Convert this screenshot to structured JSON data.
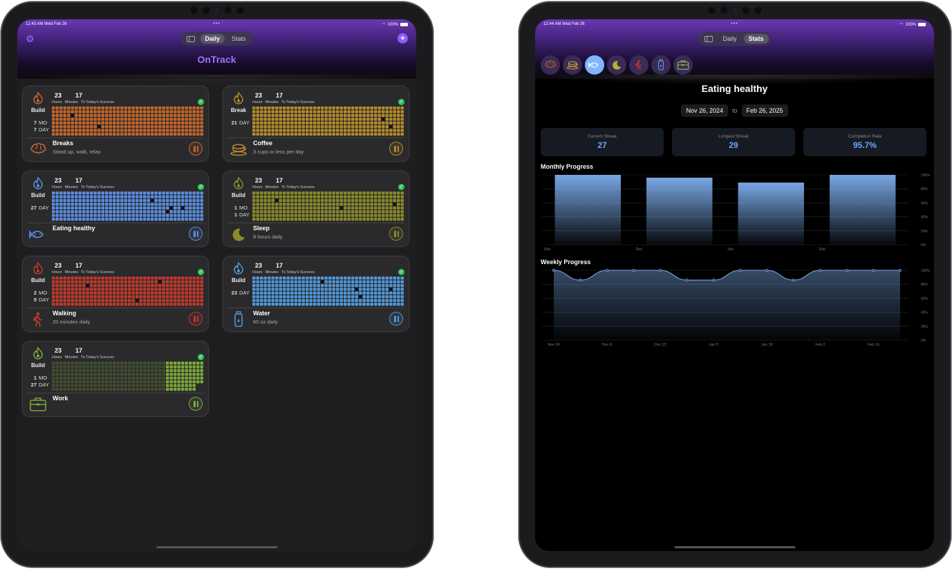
{
  "left": {
    "status": {
      "time": "12:43 AM  Wed Feb 26",
      "battery": "100%"
    },
    "tabs": [
      "Daily",
      "Stats"
    ],
    "active_tab": "Daily",
    "app_title": "OnTrack",
    "labels": {
      "hours": "Hours",
      "minutes": "Minutes",
      "to_success": "To Today's Success"
    },
    "habits": [
      {
        "name": "Breaks",
        "desc": "Stand up, walk, relax",
        "mode": "Build",
        "hours": "23",
        "minutes": "17",
        "stats": [
          {
            "n": "7",
            "u": "MO"
          },
          {
            "n": "7",
            "u": "DAY"
          }
        ],
        "color": "#c4652a",
        "fill_fraction": 1.0,
        "icon": "brain-icon"
      },
      {
        "name": "Coffee",
        "desc": "3 cups or less per day",
        "mode": "Break",
        "hours": "23",
        "minutes": "17",
        "stats": [
          {
            "n": "21",
            "u": "DAY"
          }
        ],
        "color": "#b58a2a",
        "fill_fraction": 1.0,
        "icon": "coffee-cup-icon"
      },
      {
        "name": "Eating healthy",
        "desc": "",
        "mode": "Build",
        "hours": "23",
        "minutes": "17",
        "stats": [
          {
            "n": "27",
            "u": "DAY"
          }
        ],
        "color": "#5a8ee0",
        "fill_fraction": 1.0,
        "icon": "fish-icon"
      },
      {
        "name": "Sleep",
        "desc": "8 hours daily",
        "mode": "Build",
        "hours": "23",
        "minutes": "17",
        "stats": [
          {
            "n": "1",
            "u": "MO"
          },
          {
            "n": "1",
            "u": "DAY"
          }
        ],
        "color": "#8a8a2a",
        "fill_fraction": 1.0,
        "icon": "moon-icon"
      },
      {
        "name": "Walking",
        "desc": "20 minutes daily",
        "mode": "Build",
        "hours": "23",
        "minutes": "17",
        "stats": [
          {
            "n": "2",
            "u": "MO"
          },
          {
            "n": "5",
            "u": "DAY"
          }
        ],
        "color": "#c0392b",
        "fill_fraction": 1.0,
        "icon": "walking-person-icon"
      },
      {
        "name": "Water",
        "desc": "60 oz daily",
        "mode": "Build",
        "hours": "23",
        "minutes": "17",
        "stats": [
          {
            "n": "23",
            "u": "DAY"
          }
        ],
        "color": "#4f98d8",
        "fill_fraction": 1.0,
        "icon": "water-bottle-icon"
      },
      {
        "name": "Work",
        "desc": "",
        "mode": "Build",
        "hours": "23",
        "minutes": "17",
        "stats": [
          {
            "n": "1",
            "u": "MO"
          },
          {
            "n": "27",
            "u": "DAY"
          }
        ],
        "color": "#7da83a",
        "fill_fraction": 0.25,
        "icon": "briefcase-icon"
      }
    ]
  },
  "right": {
    "status": {
      "time": "12:44 AM  Wed Feb 26",
      "battery": "100%"
    },
    "tabs": [
      "Daily",
      "Stats"
    ],
    "active_tab": "Stats",
    "habit_icons": [
      "brain-icon",
      "coffee-cup-icon",
      "fish-icon",
      "moon-icon",
      "walking-person-icon",
      "water-bottle-icon",
      "briefcase-icon"
    ],
    "selected_habit": "Eating healthy",
    "date_from": "Nov 26, 2024",
    "date_to_label": "to",
    "date_to": "Feb 26, 2025",
    "metrics": [
      {
        "label": "Current Streak",
        "value": "27"
      },
      {
        "label": "Longest Streak",
        "value": "29"
      },
      {
        "label": "Completion Rate",
        "value": "95.7%"
      }
    ],
    "monthly_title": "Monthly Progress",
    "weekly_title": "Weekly Progress"
  },
  "chart_data": [
    {
      "type": "bar",
      "title": "Monthly Progress",
      "categories": [
        "Nov",
        "Dec",
        "Jan",
        "Feb"
      ],
      "values": [
        100,
        96,
        89,
        100
      ],
      "ylim": [
        0,
        100
      ],
      "yticks": [
        "100%",
        "80%",
        "60%",
        "40%",
        "20%",
        "0%"
      ],
      "grid": true,
      "color": "#7fb0f0"
    },
    {
      "type": "area",
      "title": "Weekly Progress",
      "x": [
        "Nov 24",
        "Dec 1",
        "Dec 8",
        "Dec 15",
        "Dec 22",
        "Dec 29",
        "Jan 5",
        "Jan 12",
        "Jan 19",
        "Jan 26",
        "Feb 2",
        "Feb 9",
        "Feb 16",
        "Feb 23"
      ],
      "xticks": [
        "Nov 24",
        "Dec 8",
        "Dec 22",
        "Jan 5",
        "Jan 19",
        "Feb 2",
        "Feb 16"
      ],
      "values": [
        100,
        86,
        100,
        100,
        100,
        86,
        86,
        100,
        100,
        86,
        100,
        100,
        100,
        100
      ],
      "ylim": [
        0,
        100
      ],
      "yticks": [
        "100%",
        "80%",
        "60%",
        "40%",
        "20%",
        "0%"
      ],
      "grid": true,
      "color": "#7fb0f0"
    }
  ]
}
